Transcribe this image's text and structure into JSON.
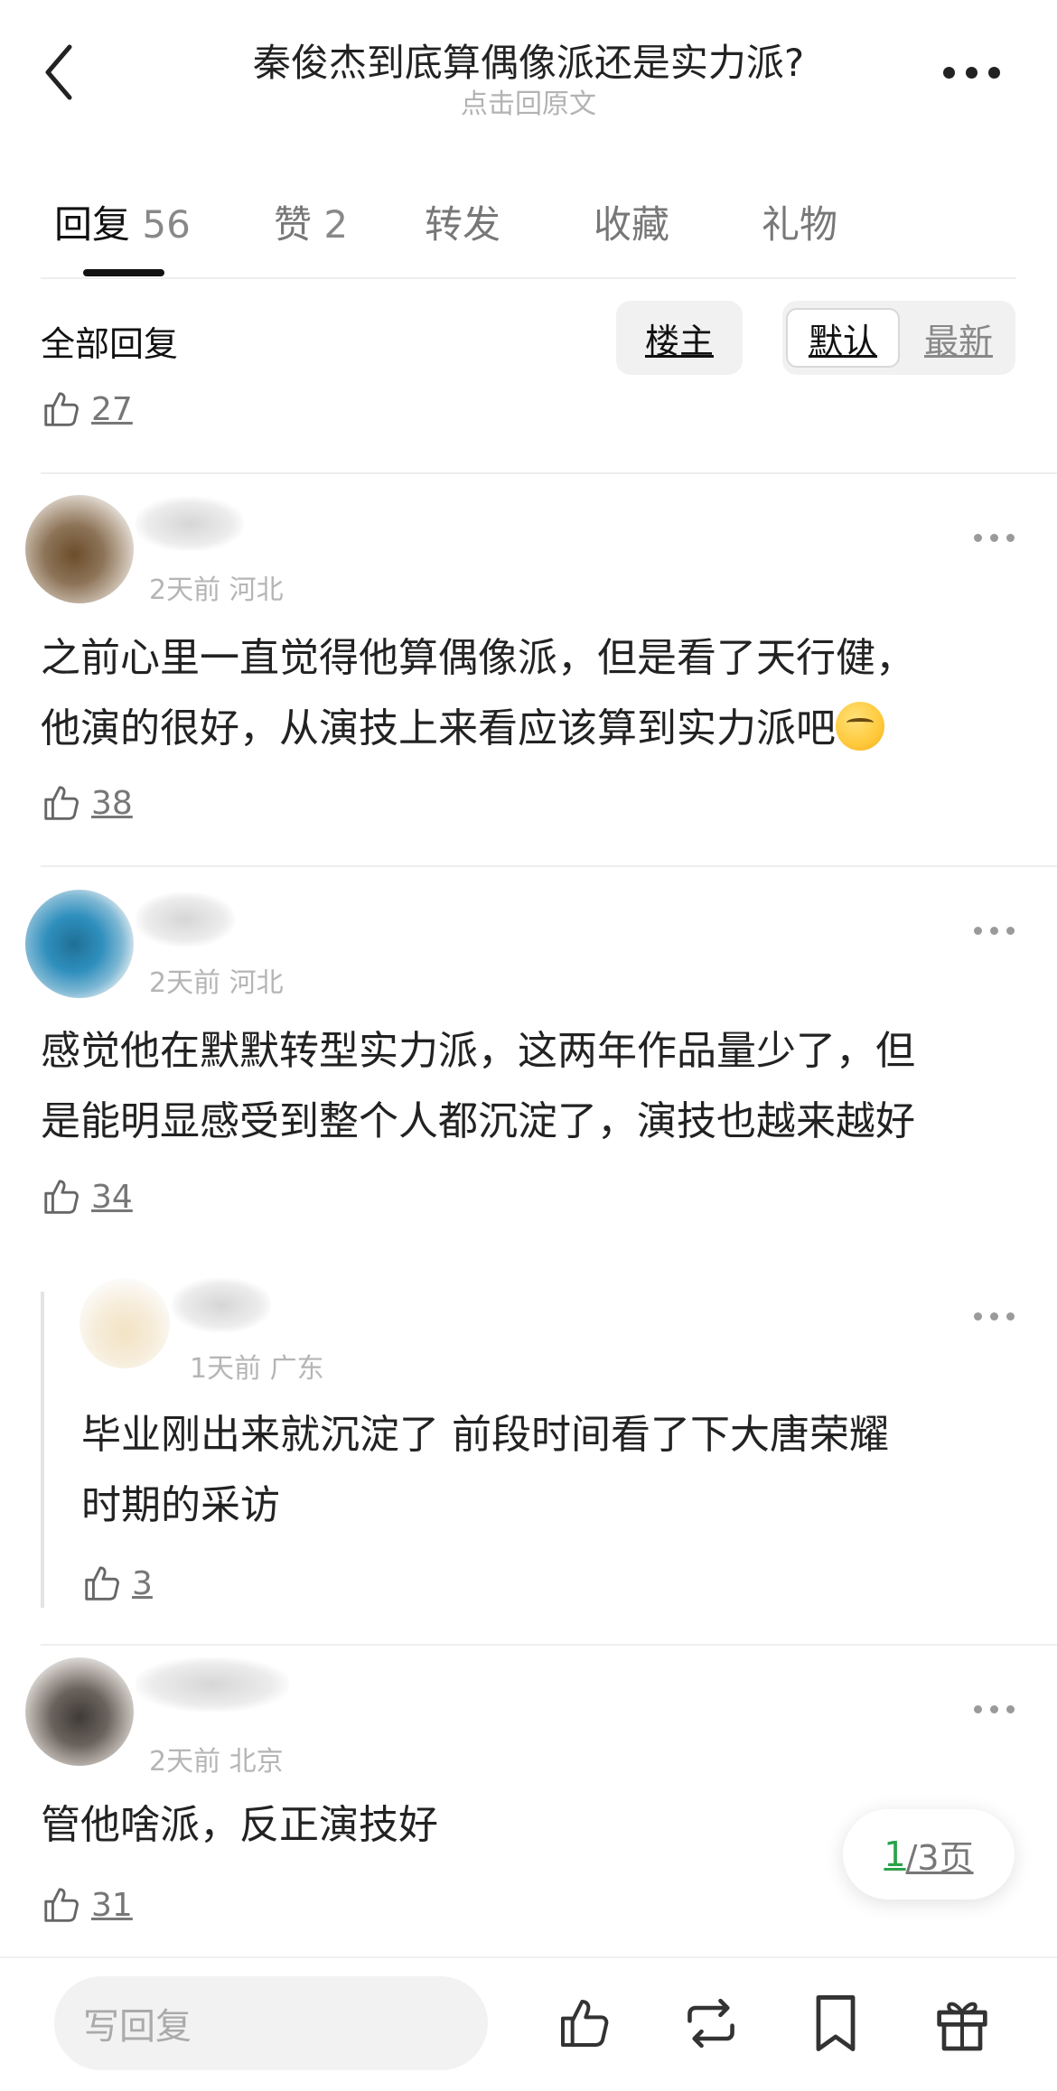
{
  "header": {
    "title": "秦俊杰到底算偶像派还是实力派?",
    "subtitle": "点击回原文"
  },
  "tabs": [
    {
      "label": "回复",
      "count": "56"
    },
    {
      "label": "赞",
      "count": "2"
    },
    {
      "label": "转发",
      "count": ""
    },
    {
      "label": "收藏",
      "count": ""
    },
    {
      "label": "礼物",
      "count": ""
    }
  ],
  "filter": {
    "label": "全部回复",
    "op_only": "楼主",
    "sort_default": "默认",
    "sort_latest": "最新"
  },
  "top_like_count": "27",
  "comments": [
    {
      "meta_time": "2天前",
      "meta_region": "河北",
      "lines": [
        "之前心里一直觉得他算偶像派，但是看了天行健，",
        "他演的很好，从演技上来看应该算到实力派吧"
      ],
      "emoji": "thinking-face",
      "likes": "38"
    },
    {
      "meta_time": "2天前",
      "meta_region": "河北",
      "lines": [
        "感觉他在默默转型实力派，这两年作品量少了，但",
        "是能明显感受到整个人都沉淀了，演技也越来越好"
      ],
      "likes": "34"
    },
    {
      "meta_time": "1天前",
      "meta_region": "广东",
      "lines": [
        "毕业刚出来就沉淀了 前段时间看了下大唐荣耀",
        "时期的采访"
      ],
      "likes": "3"
    },
    {
      "meta_time": "2天前",
      "meta_region": "北京",
      "lines": [
        "管他啥派，反正演技好"
      ],
      "likes": "31"
    }
  ],
  "pager": {
    "current": "1",
    "total_text": "/3页"
  },
  "bottom": {
    "reply_placeholder": "写回复"
  },
  "colors": {
    "accent_green": "#2ba34a"
  }
}
